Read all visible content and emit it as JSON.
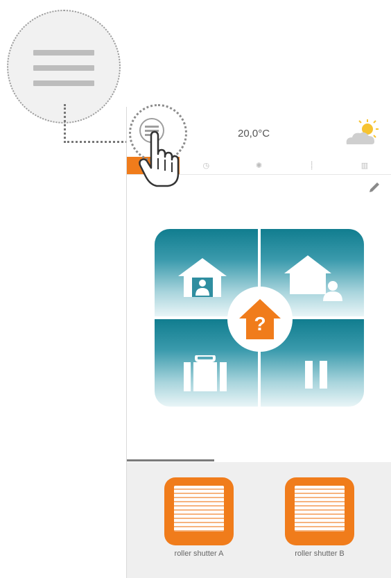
{
  "header": {
    "temperature": "20,0°C",
    "weather_icon": "partly-cloudy-icon",
    "menu_icon": "menu-icon"
  },
  "tabs": [
    {
      "icon": "star-icon",
      "glyph": "★",
      "active": true
    },
    {
      "icon": "clock-icon",
      "glyph": "◷",
      "active": false
    },
    {
      "icon": "sun-icon",
      "glyph": "✺",
      "active": false
    },
    {
      "icon": "thermometer-icon",
      "glyph": "⸽",
      "active": false
    },
    {
      "icon": "device-icon",
      "glyph": "▥",
      "active": false
    }
  ],
  "modes": {
    "items": [
      "home-present-icon",
      "home-away-icon",
      "vacation-icon",
      "pause-icon"
    ],
    "center": "?",
    "center_icon": "unknown-mode-icon"
  },
  "devices": [
    {
      "label": "roller shutter A",
      "icon": "roller-shutter-icon"
    },
    {
      "label": "roller shutter B",
      "icon": "roller-shutter-icon"
    }
  ],
  "colors": {
    "accent": "#f07c1b",
    "teal": "#117d8f",
    "background_panel": "#efefef"
  }
}
